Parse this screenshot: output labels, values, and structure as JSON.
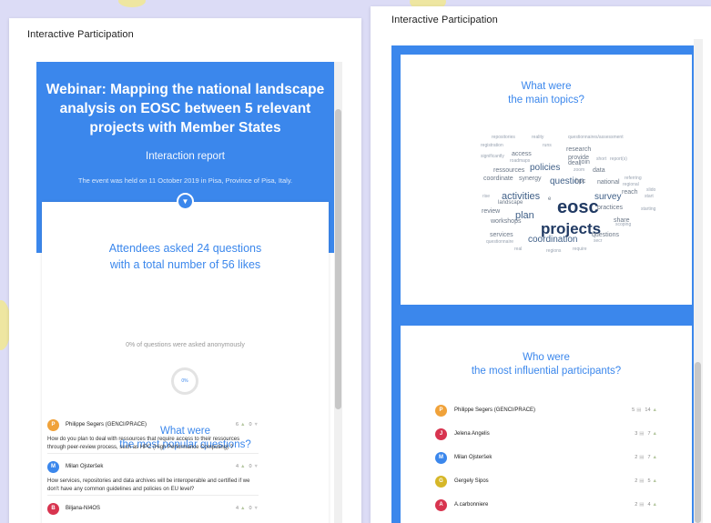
{
  "left": {
    "title": "Interactive Participation",
    "hero": {
      "title": "Webinar: Mapping the national landscape analysis on EOSC between 5 relevant projects with Member States",
      "subtitle": "Interaction report",
      "description": "The event was held on 11 October 2019 in Pisa, Province of Pisa, Italy."
    },
    "stats_line1": "Attendees asked 24 questions",
    "stats_line2": "with a total number of 56 likes",
    "anon_text": "0% of questions were asked anonymously",
    "donut_label": "0%",
    "popular_title_1": "What were",
    "popular_title_2": "the most popular questions?",
    "questions": [
      {
        "initial": "P",
        "color": "#f0a23a",
        "author": "Philippe Segers (GENCI/PRACE)",
        "likes": "6",
        "dislikes": "0",
        "text": "How do you plan to deal with ressources that require access to their ressources through peer-review process, such as HPC (High Performance Computing) ?"
      },
      {
        "initial": "M",
        "color": "#3b87ec",
        "author": "Milan Ojsteršek",
        "likes": "4",
        "dislikes": "0",
        "text": "How services, repositories and data archives will be interoperable and certified if we don't have any common guidelines and policies on EU level?"
      },
      {
        "initial": "B",
        "color": "#d8344f",
        "author": "Biljana-NI4OS",
        "likes": "4",
        "dislikes": "0",
        "text": ""
      }
    ]
  },
  "right": {
    "title": "Interactive Participation",
    "topics_title_1": "What were",
    "topics_title_2": "the main topics?",
    "influential_title_1": "Who were",
    "influential_title_2": "the most influential participants?",
    "participants": [
      {
        "initial": "P",
        "color": "#f0a23a",
        "name": "Philippe Segers (GENCI/PRACE)",
        "questions": "5",
        "likes": "14"
      },
      {
        "initial": "J",
        "color": "#d8344f",
        "name": "Jelena Angelis",
        "questions": "3",
        "likes": "7"
      },
      {
        "initial": "M",
        "color": "#3b87ec",
        "name": "Milan Ojsteršek",
        "questions": "2",
        "likes": "7"
      },
      {
        "initial": "G",
        "color": "#d6b728",
        "name": "Gergely Sipos",
        "questions": "2",
        "likes": "5"
      },
      {
        "initial": "A",
        "color": "#d8344f",
        "name": "A.carbonniere",
        "questions": "2",
        "likes": "4"
      }
    ]
  },
  "word_cloud": [
    {
      "text": "repositories",
      "size": 5,
      "color": "#9aa4b2"
    },
    {
      "text": "reality",
      "size": 5,
      "color": "#9aa4b2"
    },
    {
      "text": "questionnaires/assessment",
      "size": 5,
      "color": "#9aa4b2"
    },
    {
      "text": "registration",
      "size": 5,
      "color": "#9aa4b2"
    },
    {
      "text": "runs",
      "size": 5,
      "color": "#9aa4b2"
    },
    {
      "text": "research",
      "size": 7,
      "color": "#6b7787"
    },
    {
      "text": "access",
      "size": 7,
      "color": "#6b7787"
    },
    {
      "text": "provide",
      "size": 7,
      "color": "#6b7787"
    },
    {
      "text": "significantly",
      "size": 5,
      "color": "#9aa4b2"
    },
    {
      "text": "roadmaps",
      "size": 5,
      "color": "#9aa4b2"
    },
    {
      "text": "policies",
      "size": 10,
      "color": "#3f5f87"
    },
    {
      "text": "deal",
      "size": 7,
      "color": "#6b7787"
    },
    {
      "text": "join",
      "size": 7,
      "color": "#6b7787"
    },
    {
      "text": "short",
      "size": 5,
      "color": "#9aa4b2"
    },
    {
      "text": "report(s)",
      "size": 5,
      "color": "#9aa4b2"
    },
    {
      "text": "ressources",
      "size": 7,
      "color": "#6b7787"
    },
    {
      "text": "zoom",
      "size": 5,
      "color": "#9aa4b2"
    },
    {
      "text": "data",
      "size": 7,
      "color": "#6b7787"
    },
    {
      "text": "coordinate",
      "size": 7,
      "color": "#6b7787"
    },
    {
      "text": "synergy",
      "size": 7,
      "color": "#6b7787"
    },
    {
      "text": "question",
      "size": 10,
      "color": "#3f5f87"
    },
    {
      "text": "hpc",
      "size": 7,
      "color": "#6b7787"
    },
    {
      "text": "national",
      "size": 7,
      "color": "#6b7787"
    },
    {
      "text": "referring",
      "size": 5,
      "color": "#9aa4b2"
    },
    {
      "text": "regional",
      "size": 5,
      "color": "#9aa4b2"
    },
    {
      "text": "activities",
      "size": 11,
      "color": "#3f5f87"
    },
    {
      "text": "eosc",
      "size": 20,
      "color": "#213a63"
    },
    {
      "text": "survey",
      "size": 10,
      "color": "#3f5f87"
    },
    {
      "text": "reach",
      "size": 7,
      "color": "#6b7787"
    },
    {
      "text": "slido",
      "size": 5,
      "color": "#9aa4b2"
    },
    {
      "text": "start",
      "size": 5,
      "color": "#9aa4b2"
    },
    {
      "text": "rise",
      "size": 5,
      "color": "#9aa4b2"
    },
    {
      "text": "landscape",
      "size": 6,
      "color": "#6b7787"
    },
    {
      "text": "e",
      "size": 6,
      "color": "#6b7787"
    },
    {
      "text": "review",
      "size": 7,
      "color": "#6b7787"
    },
    {
      "text": "plan",
      "size": 11,
      "color": "#3f5f87"
    },
    {
      "text": "practices",
      "size": 7,
      "color": "#6b7787"
    },
    {
      "text": "starting",
      "size": 5,
      "color": "#9aa4b2"
    },
    {
      "text": "workshops",
      "size": 7,
      "color": "#6b7787"
    },
    {
      "text": "projects",
      "size": 17,
      "color": "#213a63"
    },
    {
      "text": "share",
      "size": 7,
      "color": "#6b7787"
    },
    {
      "text": "scoping",
      "size": 5,
      "color": "#9aa4b2"
    },
    {
      "text": "services",
      "size": 7,
      "color": "#6b7787"
    },
    {
      "text": "coordination",
      "size": 10,
      "color": "#3f5f87"
    },
    {
      "text": "questions",
      "size": 7,
      "color": "#6b7787"
    },
    {
      "text": "questionnaire",
      "size": 5,
      "color": "#9aa4b2"
    },
    {
      "text": "secr",
      "size": 5,
      "color": "#9aa4b2"
    },
    {
      "text": "real",
      "size": 5,
      "color": "#9aa4b2"
    },
    {
      "text": "regions",
      "size": 5,
      "color": "#9aa4b2"
    },
    {
      "text": "require",
      "size": 5,
      "color": "#9aa4b2"
    }
  ]
}
